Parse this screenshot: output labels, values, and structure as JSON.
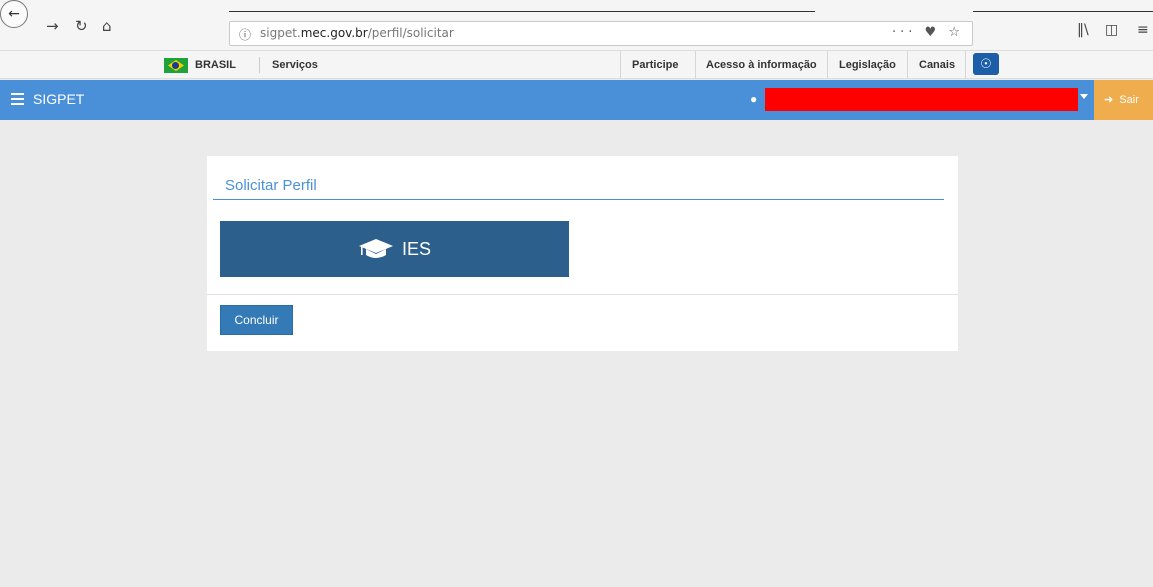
{
  "browser": {
    "url_prefix": "sigpet.",
    "url_domain": "mec.gov.br",
    "url_path": "/perfil/solicitar",
    "url_actions": "··· ♥ ☆"
  },
  "gov_bar": {
    "brasil_label": "BRASIL",
    "services_label": "Serviços",
    "items": [
      "Participe",
      "Acesso à informação",
      "Legislação",
      "Canais"
    ]
  },
  "app_header": {
    "title": "SIGPET",
    "logout_label": "Sair"
  },
  "panel": {
    "title": "Solicitar Perfil",
    "profile_option": "IES",
    "submit_label": "Concluir"
  },
  "colors": {
    "header_blue": "#4a90d9",
    "card_blue": "#2c5f8c",
    "button_blue": "#337ab7",
    "logout_orange": "#f0ad4e",
    "redaction": "#ff0000"
  }
}
